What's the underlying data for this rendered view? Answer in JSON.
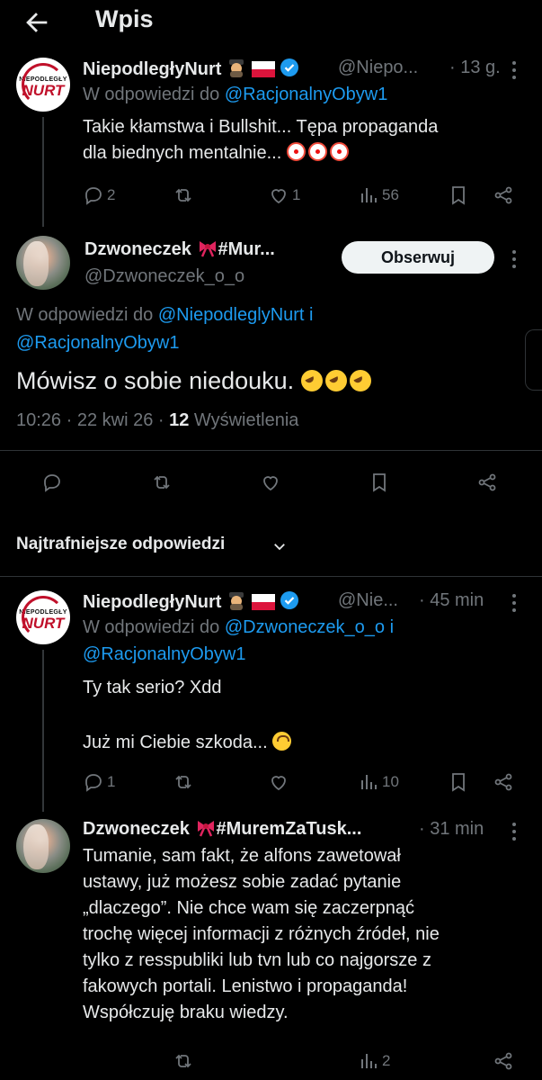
{
  "header": {
    "title": "Wpis",
    "back_icon": "arrow-left-icon"
  },
  "colors": {
    "background": "#000000",
    "text": "#e7e9ea",
    "muted": "#71767b",
    "link": "#1d9bf0",
    "verified": "#1d9bf0"
  },
  "posts": {
    "parent": {
      "avatar_text_small": "NIEPODLEGŁY",
      "avatar_text_big": "NURT",
      "name": "NiepodległyNurt",
      "handle": "@Niepo...",
      "time": "· 13 g.",
      "reply_prefix": "W odpowiedzi do",
      "reply_to": "@RacjonalnyObyw1",
      "text_line1": "Takie kłamstwa i Bullshit... Tępa propaganda",
      "text_line2": "dla biednych mentalnie...",
      "replies": "2",
      "likes": "1",
      "views": "56"
    },
    "main": {
      "name": "Dzwoneczek",
      "name_suffix": "#Mur...",
      "handle": "@Dzwoneczek_o_o",
      "follow_label": "Obserwuj",
      "reply_prefix": "W odpowiedzi do",
      "reply_to_1": "@NiepodleglyNurt",
      "reply_joiner": "i",
      "reply_to_2": "@RacjonalnyObyw1",
      "text": "Mówisz o sobie niedouku.",
      "time": "10:26 · 22 kwi 26 ·",
      "views_count": "12",
      "views_label": "Wyświetlenia"
    },
    "sort_label": "Najtrafniejsze odpowiedzi",
    "reply1": {
      "avatar_text_small": "NIEPODLEGŁY",
      "avatar_text_big": "NURT",
      "name": "NiepodległyNurt",
      "handle": "@Nie...",
      "time": "· 45 min",
      "reply_prefix": "W odpowiedzi do",
      "reply_to_1": "@Dzwoneczek_o_o",
      "reply_joiner": "i",
      "reply_to_2": "@RacjonalnyObyw1",
      "text_line1": "Ty tak serio? Xdd",
      "text_line2": "Już mi Ciebie szkoda...",
      "replies": "1",
      "views": "10"
    },
    "reply2": {
      "name": "Dzwoneczek",
      "name_suffix": "#MuremZaTusk...",
      "time": "· 31 min",
      "lines": [
        "Tumanie, sam fakt, że alfons zawetował",
        "ustawy, już możesz sobie zadać pytanie",
        "„dlaczego”. Nie chce wam się zaczerpnąć",
        "trochę więcej informacji z różnych źródeł, nie",
        "tylko z resspubliki lub tvn lub co najgorsze z",
        "fakowych portali. Lenistwo i propaganda!",
        "Współczuję braku wiedzy."
      ],
      "views": "2"
    }
  }
}
